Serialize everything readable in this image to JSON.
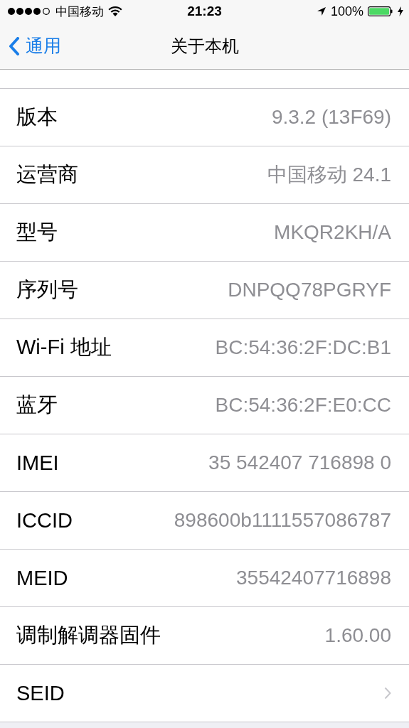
{
  "status_bar": {
    "carrier": "中国移动",
    "time": "21:23",
    "battery": "100%"
  },
  "nav": {
    "back": "通用",
    "title": "关于本机"
  },
  "rows": [
    {
      "kind": "value",
      "label": "版本",
      "value": "9.3.2 (13F69)"
    },
    {
      "kind": "value",
      "label": "运营商",
      "value": "中国移动 24.1"
    },
    {
      "kind": "value",
      "label": "型号",
      "value": "MKQR2KH/A"
    },
    {
      "kind": "value",
      "label": "序列号",
      "value": "DNPQQ78PGRYF"
    },
    {
      "kind": "value",
      "label": "Wi-Fi 地址",
      "value": "BC:54:36:2F:DC:B1"
    },
    {
      "kind": "value",
      "label": "蓝牙",
      "value": "BC:54:36:2F:E0:CC"
    },
    {
      "kind": "value",
      "label": "IMEI",
      "value": "35 542407 716898 0"
    },
    {
      "kind": "value",
      "label": "ICCID",
      "value": "898600b1111557086787"
    },
    {
      "kind": "value",
      "label": "MEID",
      "value": "35542407716898"
    },
    {
      "kind": "value",
      "label": "调制解调器固件",
      "value": "1.60.00"
    },
    {
      "kind": "link",
      "label": "SEID"
    }
  ]
}
